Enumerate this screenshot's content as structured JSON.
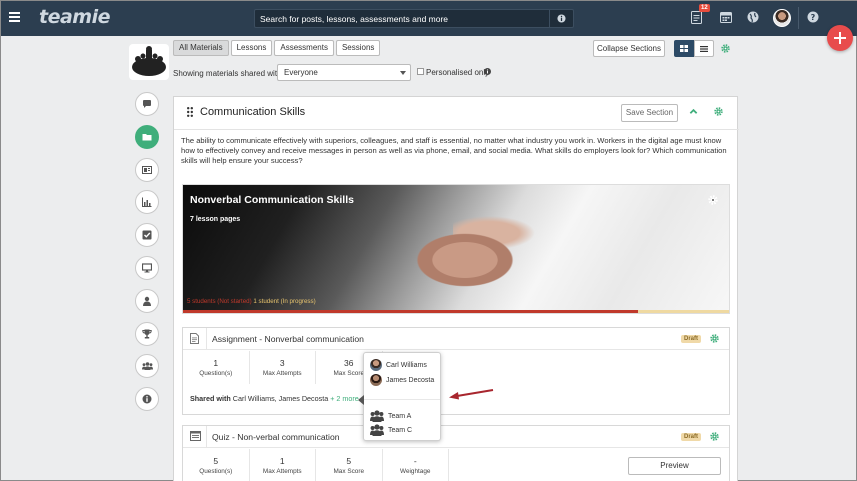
{
  "topbar": {
    "logo": "teamie",
    "search_placeholder": "Search for posts, lessons, assessments and more",
    "notification_count": "12",
    "icons": [
      "menu-icon",
      "info-icon",
      "notification-icon",
      "calendar-icon",
      "globe-icon",
      "avatar",
      "help-icon"
    ],
    "fab_icon": "plus-icon",
    "colors": {
      "bar": "#2c3e50",
      "fab": "#e84c4c",
      "accent": "#3fae7b"
    }
  },
  "toolbar": {
    "tabs": [
      "All Materials",
      "Lessons",
      "Assessments",
      "Sessions"
    ],
    "active_tab": "All Materials",
    "share_label": "Showing materials shared with",
    "share_value": "Everyone",
    "personalised_label": "Personalised only",
    "collapse_label": "Collapse Sections"
  },
  "sidebar": {
    "items": [
      "chat-icon",
      "folder-icon",
      "gradebook-icon",
      "chart-icon",
      "checkbox-icon",
      "monitor-icon",
      "user-icon",
      "trophy-icon",
      "group-icon",
      "info-icon"
    ],
    "active_index": 1
  },
  "section": {
    "title": "Communication Skills",
    "save_label": "Save Section",
    "description": "The ability to communicate effectively with superiors, colleagues, and staff is essential, no matter what industry you work in. Workers in the digital age must know how to effectively convey and receive messages in person as well as via phone, email, and social media. What skills do employers look for? Which communication skills will help ensure your success?",
    "lesson": {
      "title": "Nonverbal Communication Skills",
      "pages": "7 lesson pages",
      "not_started": "5 students (Not started)",
      "in_progress": "1 student (In progress)",
      "progress_fraction": 0.83
    }
  },
  "cards": [
    {
      "title": "Assignment - Nonverbal communication",
      "badge": "Draft",
      "stats": [
        {
          "value": "1",
          "label": "Question(s)"
        },
        {
          "value": "3",
          "label": "Max Attempts"
        },
        {
          "value": "36",
          "label": "Max Score"
        }
      ],
      "shared_label": "Shared with",
      "shared_names": "Carl Williams, James Decosta",
      "more": "+ 2 more"
    },
    {
      "title": "Quiz - Non-verbal communication",
      "badge": "Draft",
      "stats": [
        {
          "value": "5",
          "label": "Question(s)"
        },
        {
          "value": "1",
          "label": "Max Attempts"
        },
        {
          "value": "5",
          "label": "Max Score"
        },
        {
          "value": "-",
          "label": "Weightage"
        }
      ],
      "preview_label": "Preview"
    }
  ],
  "popover": {
    "users": [
      "Carl Williams",
      "James Decosta"
    ],
    "teams": [
      "Team A",
      "Team C"
    ]
  }
}
